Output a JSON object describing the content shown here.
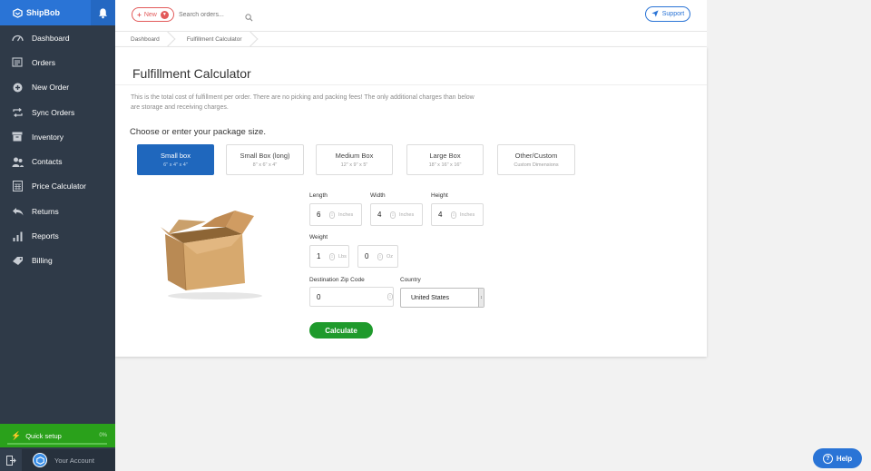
{
  "app": {
    "logo_text": "ShipBob"
  },
  "sidebar": {
    "items": [
      {
        "label": "Dashboard",
        "icon": "speedometer-icon"
      },
      {
        "label": "Orders",
        "icon": "orders-icon"
      },
      {
        "label": "New Order",
        "icon": "plus-circle-icon"
      },
      {
        "label": "Sync Orders",
        "icon": "sync-icon"
      },
      {
        "label": "Inventory",
        "icon": "archive-icon"
      },
      {
        "label": "Contacts",
        "icon": "contacts-icon"
      },
      {
        "label": "Price Calculator",
        "icon": "calculator-icon"
      },
      {
        "label": "Returns",
        "icon": "return-icon"
      },
      {
        "label": "Reports",
        "icon": "bar-chart-icon"
      },
      {
        "label": "Billing",
        "icon": "tag-icon"
      }
    ],
    "quick_setup": {
      "label": "Quick setup",
      "percent": "0%"
    },
    "account_label": "Your Account"
  },
  "topbar": {
    "new_label": "New",
    "search_placeholder": "Search orders...",
    "support_label": "Support"
  },
  "breadcrumb": [
    "Dashboard",
    "Fulfillment Calculator"
  ],
  "main": {
    "title": "Fulfillment Calculator",
    "description": "This is the total cost of fulfillment per order. There are no picking and packing fees! The only additional charges than below are storage and receiving charges.",
    "choose_label": "Choose or enter your package size.",
    "packages": [
      {
        "name": "Small box",
        "dims": "6\" x 4\" x 4\"",
        "active": true
      },
      {
        "name": "Small Box (long)",
        "dims": "8\" x 6\" x 4\"",
        "active": false
      },
      {
        "name": "Medium Box",
        "dims": "12\" x 9\" x 5\"",
        "active": false
      },
      {
        "name": "Large Box",
        "dims": "18\" x 16\" x 16\"",
        "active": false
      },
      {
        "name": "Other/Custom",
        "dims": "Custom Dimensions",
        "active": false
      }
    ],
    "length": {
      "label": "Length",
      "value": "6",
      "unit": "Inches"
    },
    "width": {
      "label": "Width",
      "value": "4",
      "unit": "Inches"
    },
    "height": {
      "label": "Height",
      "value": "4",
      "unit": "Inches"
    },
    "weight": {
      "label": "Weight",
      "lbs_value": "1",
      "lbs_unit": "Lbs",
      "oz_value": "0",
      "oz_unit": "Oz"
    },
    "zip": {
      "label": "Destination Zip Code",
      "value": "0"
    },
    "country": {
      "label": "Country",
      "value": "United States"
    },
    "calculate_label": "Calculate"
  },
  "help_label": "Help",
  "colors": {
    "sidebar_bg": "#2f3a48",
    "brand_blue": "#2a74d6",
    "active_package": "#1f67bd",
    "quick_setup_green": "#2aa11b",
    "calculate_green": "#1f9a2c",
    "new_red": "#e25a5a"
  }
}
